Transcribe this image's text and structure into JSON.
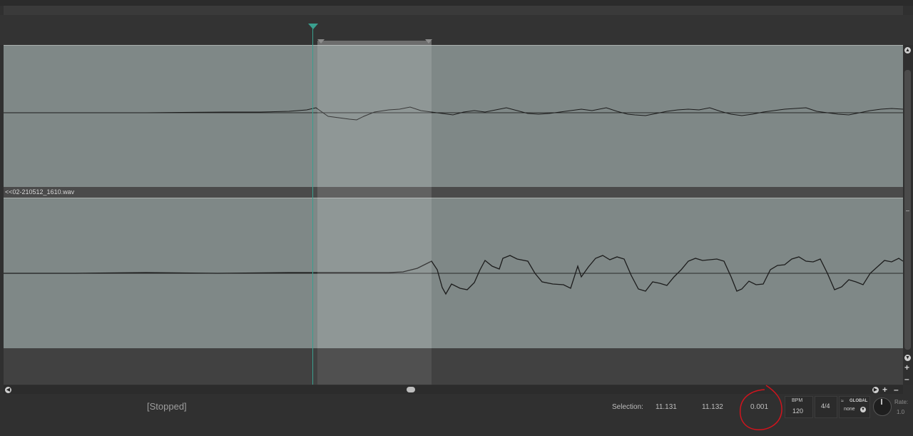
{
  "track_item": {
    "name": "<<02-210512_1610.wav"
  },
  "transport": {
    "status": "[Stopped]"
  },
  "selection": {
    "label": "Selection:",
    "start": "11.131",
    "end": "11.132",
    "length": "0.001"
  },
  "tempo": {
    "bpm_label": "BPM",
    "bpm_value": "120",
    "time_signature": "4/4"
  },
  "playrate_mode": {
    "label": "GLOBAL",
    "value": "none"
  },
  "rate": {
    "label": "Rate:",
    "value": "1.0"
  },
  "colors": {
    "playhead": "#3aa08f",
    "track_bg": "#7f8887",
    "annotation": "#d0141d"
  },
  "icons": {
    "scroll_up": "triangle-up",
    "scroll_down": "triangle-down",
    "scroll_left": "triangle-left",
    "scroll_right": "triangle-right",
    "zoom_in": "plus",
    "zoom_out": "minus"
  }
}
